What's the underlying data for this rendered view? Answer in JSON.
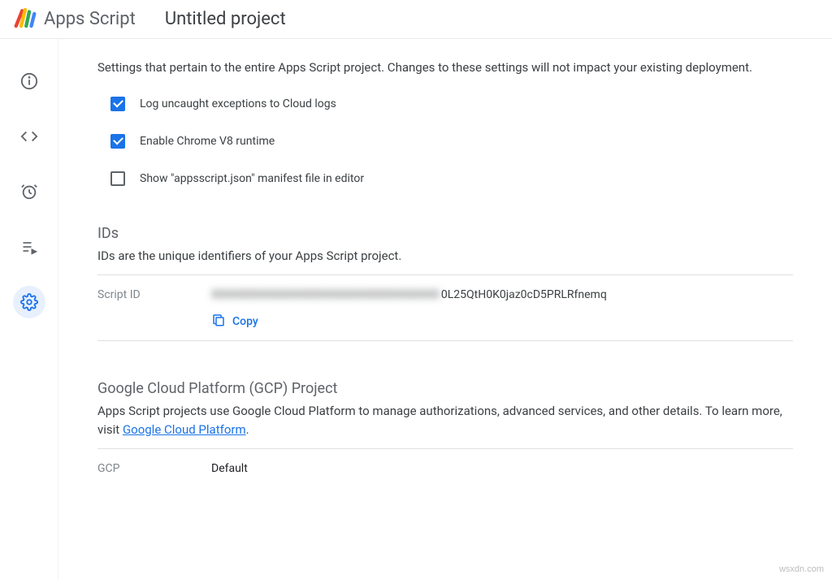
{
  "header": {
    "app_name": "Apps Script",
    "project_title": "Untitled project"
  },
  "sidebar": {
    "items": [
      {
        "name": "overview",
        "icon": "info"
      },
      {
        "name": "editor",
        "icon": "code"
      },
      {
        "name": "triggers",
        "icon": "alarm"
      },
      {
        "name": "executions",
        "icon": "list"
      },
      {
        "name": "settings",
        "icon": "gear",
        "active": true
      }
    ]
  },
  "settings": {
    "intro": "Settings that pertain to the entire Apps Script project. Changes to these settings will not impact your existing deployment.",
    "options": [
      {
        "label": "Log uncaught exceptions to Cloud logs",
        "checked": true
      },
      {
        "label": "Enable Chrome V8 runtime",
        "checked": true
      },
      {
        "label": "Show \"appsscript.json\" manifest file in editor",
        "checked": false
      }
    ]
  },
  "ids": {
    "heading": "IDs",
    "desc": "IDs are the unique identifiers of your Apps Script project.",
    "script_id_label": "Script ID",
    "script_id_hidden": "XXXXXXXXXXXXXXXXXXXXXXXXXXXXXXXX",
    "script_id_visible": "0L25QtH0K0jaz0cD5PRLRfnemq",
    "copy_label": "Copy"
  },
  "gcp": {
    "heading": "Google Cloud Platform (GCP) Project",
    "desc_pre": "Apps Script projects use Google Cloud Platform to manage authorizations, advanced services, and other details. To learn more, visit ",
    "link_text": "Google Cloud Platform",
    "desc_post": ".",
    "label": "GCP",
    "value": "Default"
  },
  "watermark": "wsxdn.com"
}
